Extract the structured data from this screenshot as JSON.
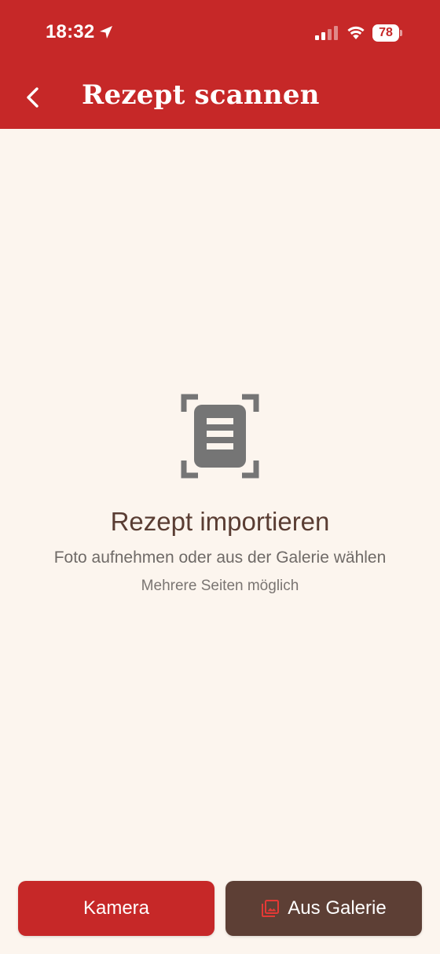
{
  "status_bar": {
    "time": "18:32",
    "battery": "78",
    "icons": [
      "location-arrow-icon",
      "cellular-signal-icon",
      "wifi-icon",
      "battery-icon"
    ]
  },
  "nav": {
    "back_icon": "chevron-left-icon",
    "title": "Rezept scannen"
  },
  "empty_state": {
    "icon": "document-scan-icon",
    "title": "Rezept importieren",
    "subtitle": "Foto aufnehmen oder aus der Galerie wählen",
    "hint": "Mehrere Seiten möglich"
  },
  "actions": {
    "camera_label": "Kamera",
    "gallery_label": "Aus Galerie",
    "gallery_icon": "photo-library-icon"
  },
  "colors": {
    "primary": "#c62828",
    "secondary": "#5d3f35",
    "background": "#fcf5ee",
    "icon_gray": "#757575"
  }
}
